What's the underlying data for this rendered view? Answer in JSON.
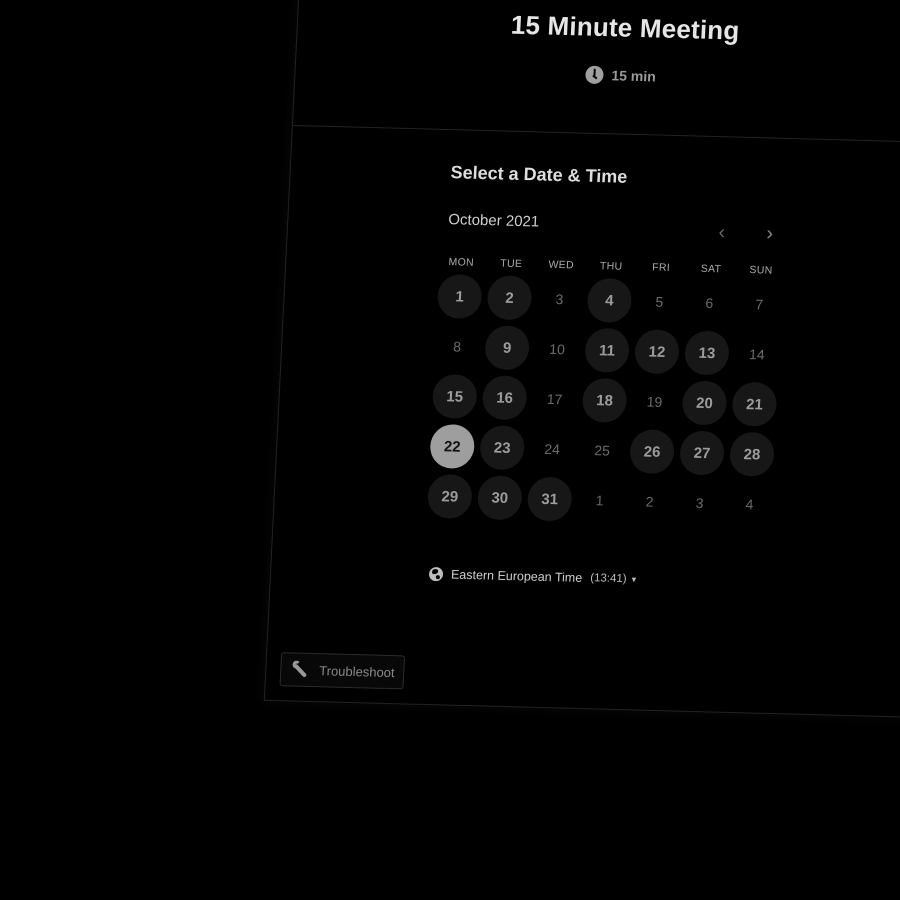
{
  "event": {
    "title": "15 Minute Meeting",
    "duration": "15 min",
    "duration_icon": "clock-icon"
  },
  "scheduler": {
    "heading": "Select a Date & Time",
    "month_label": "October 2021",
    "prev_icon": "‹",
    "next_icon": "›",
    "weekdays": [
      "MON",
      "TUE",
      "WED",
      "THU",
      "FRI",
      "SAT",
      "SUN"
    ],
    "days": [
      {
        "label": "1",
        "state": "available"
      },
      {
        "label": "2",
        "state": "available"
      },
      {
        "label": "3",
        "state": "unavailable"
      },
      {
        "label": "4",
        "state": "available"
      },
      {
        "label": "5",
        "state": "unavailable"
      },
      {
        "label": "6",
        "state": "unavailable"
      },
      {
        "label": "7",
        "state": "unavailable"
      },
      {
        "label": "8",
        "state": "unavailable"
      },
      {
        "label": "9",
        "state": "available"
      },
      {
        "label": "10",
        "state": "unavailable"
      },
      {
        "label": "11",
        "state": "available"
      },
      {
        "label": "12",
        "state": "available"
      },
      {
        "label": "13",
        "state": "available"
      },
      {
        "label": "14",
        "state": "unavailable"
      },
      {
        "label": "15",
        "state": "available"
      },
      {
        "label": "16",
        "state": "available"
      },
      {
        "label": "17",
        "state": "unavailable"
      },
      {
        "label": "18",
        "state": "available"
      },
      {
        "label": "19",
        "state": "unavailable"
      },
      {
        "label": "20",
        "state": "available"
      },
      {
        "label": "21",
        "state": "available"
      },
      {
        "label": "22",
        "state": "selected"
      },
      {
        "label": "23",
        "state": "available"
      },
      {
        "label": "24",
        "state": "unavailable"
      },
      {
        "label": "25",
        "state": "unavailable"
      },
      {
        "label": "26",
        "state": "available"
      },
      {
        "label": "27",
        "state": "available"
      },
      {
        "label": "28",
        "state": "available"
      },
      {
        "label": "29",
        "state": "available"
      },
      {
        "label": "30",
        "state": "available"
      },
      {
        "label": "31",
        "state": "available"
      },
      {
        "label": "1",
        "state": "other"
      },
      {
        "label": "2",
        "state": "other"
      },
      {
        "label": "3",
        "state": "other"
      },
      {
        "label": "4",
        "state": "other"
      }
    ],
    "timezone": {
      "icon": "globe-icon",
      "name": "Eastern European Time",
      "time": "(13:41)",
      "caret": "▾"
    }
  },
  "footer": {
    "troubleshoot_label": "Troubleshoot",
    "troubleshoot_icon": "wrench-icon"
  },
  "colors": {
    "background": "#000000",
    "available_day_bg": "#171717",
    "selected_day_bg": "#9e9e9e"
  }
}
